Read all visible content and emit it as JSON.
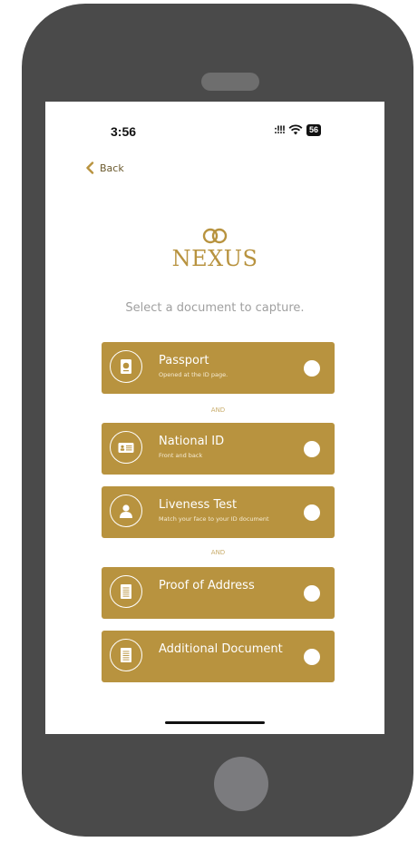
{
  "status_bar": {
    "time": "3:56",
    "signal": ":!!!",
    "battery": "56"
  },
  "nav": {
    "back_label": "Back"
  },
  "brand": {
    "name": "NEXUS"
  },
  "subtitle": "Select a document to capture.",
  "separator": "AND",
  "colors": {
    "accent": "#b8933f",
    "phone_body": "#4a4a4a"
  },
  "documents": [
    {
      "title": "Passport",
      "description": "Opened at the ID page.",
      "icon": "passport-icon",
      "selected": false
    },
    {
      "title": "National ID",
      "description": "Front and back",
      "icon": "id-card-icon",
      "selected": false
    },
    {
      "title": "Liveness Test",
      "description": "Match your face to your ID document",
      "icon": "person-icon",
      "selected": false
    },
    {
      "title": "Proof of Address",
      "description": "",
      "icon": "document-icon",
      "selected": false
    },
    {
      "title": "Additional Document",
      "description": "",
      "icon": "document-icon",
      "selected": false
    }
  ]
}
